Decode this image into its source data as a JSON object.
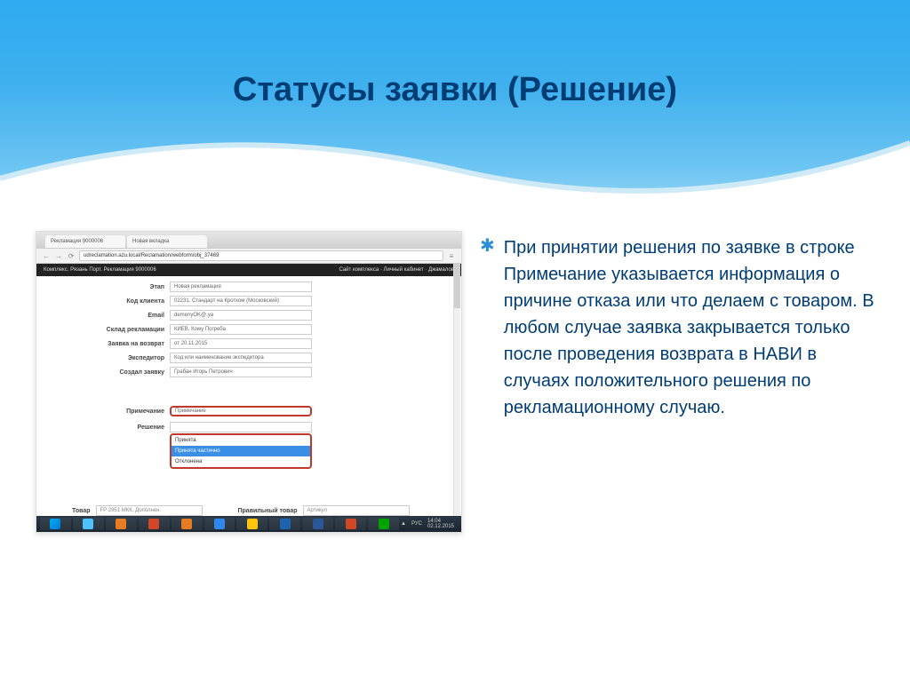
{
  "title": "Статусы заявки (Решение)",
  "bullet_mark": "✱",
  "body": "При принятии решения по заявке в строке Примечание указывается информация о причине отказа или что делаем с товаром. В любом случае заявка закрывается только после проведения возврата в НАВИ в случаях положительного решения по рекламационному случаю.",
  "screenshot": {
    "tabs": [
      {
        "label": "Рекламация 9000006"
      },
      {
        "label": "Новая вкладка"
      }
    ],
    "url": "udreclamation.azu.local/Reclamation/webform/obj_37469",
    "page_header_left": "Комплекс. Рязань Порт.   Рекламация 9000006",
    "page_header_right": "Сайт комплекса · Личный кабинет · Джамалов",
    "form": {
      "rows": [
        {
          "label": "Этап",
          "value": "Новая рекламация"
        },
        {
          "label": "Код клиента",
          "value": "02231. Стандарт на Кротком (Московский)"
        },
        {
          "label": "Email",
          "value": "demenyOK@.ya"
        },
        {
          "label": "Склад рекламации",
          "value": "КИЕВ, Кому Погреба"
        },
        {
          "label": "Заявка на возврат",
          "value": "от 20.11.2015"
        },
        {
          "label": "Экспедитор",
          "value": "Код или наименование экспедитора"
        },
        {
          "label": "Создал заявку",
          "value": "Грабан Игорь Петрович"
        }
      ],
      "notes": {
        "label": "Примечание",
        "value": "Примечание"
      },
      "decision": {
        "label": "Решение",
        "options": [
          {
            "name": "Принята",
            "selected": false
          },
          {
            "name": "Принята частично",
            "selected": true
          },
          {
            "name": "Отклонена",
            "selected": false
          }
        ]
      },
      "bottom": {
        "product_label": "Товар",
        "product_value": "FP 2951 МКК, Дополнен.",
        "correct_label": "Правильный товар",
        "correct_value": "Артикул"
      }
    },
    "tray": {
      "lang": "РУС",
      "time": "14:04",
      "date": "02.12.2015",
      "net_icon": "▲"
    }
  }
}
